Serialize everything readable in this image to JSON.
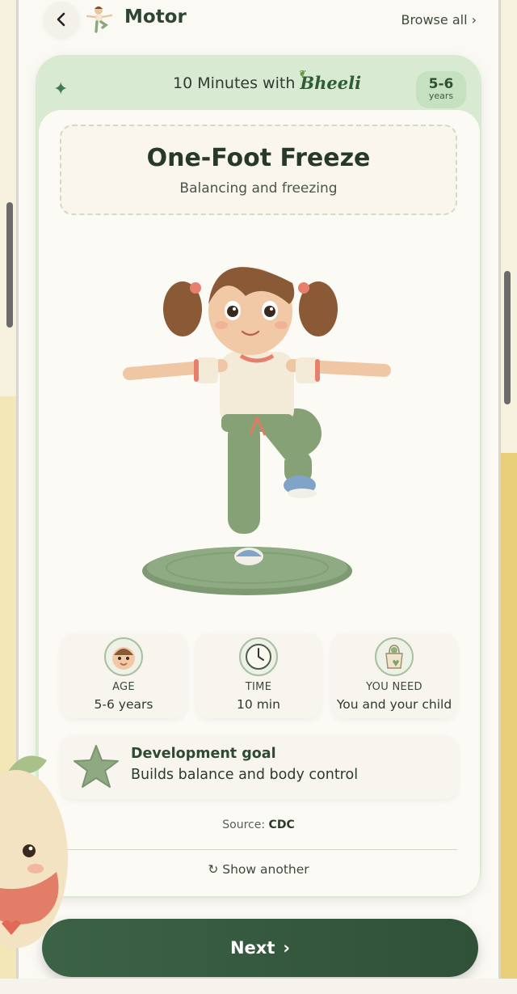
{
  "header": {
    "title": "Motor",
    "browse_all": "Browse all ›"
  },
  "banner": {
    "prefix": "10 Minutes with",
    "brand": "Bheeli",
    "age_badge": {
      "range": "5-6",
      "unit": "years"
    }
  },
  "activity": {
    "title": "One-Foot Freeze",
    "subtitle": "Balancing and freezing"
  },
  "info_cards": [
    {
      "label": "AGE",
      "value": "5-6 years",
      "icon": "baby-face-icon"
    },
    {
      "label": "TIME",
      "value": "10 min",
      "icon": "clock-icon"
    },
    {
      "label": "YOU NEED",
      "value": "You and your child",
      "icon": "tote-bag-icon"
    }
  ],
  "goal": {
    "title": "Development goal",
    "text": "Builds balance and body control"
  },
  "source": {
    "label": "Source:",
    "name": "CDC"
  },
  "show_another": "↻ Show another",
  "next": {
    "label": "Next",
    "arrow": "›"
  },
  "colors": {
    "primary": "#2f5138",
    "banner_bg": "#d9ead2",
    "badge_bg": "#c5e1bf"
  }
}
